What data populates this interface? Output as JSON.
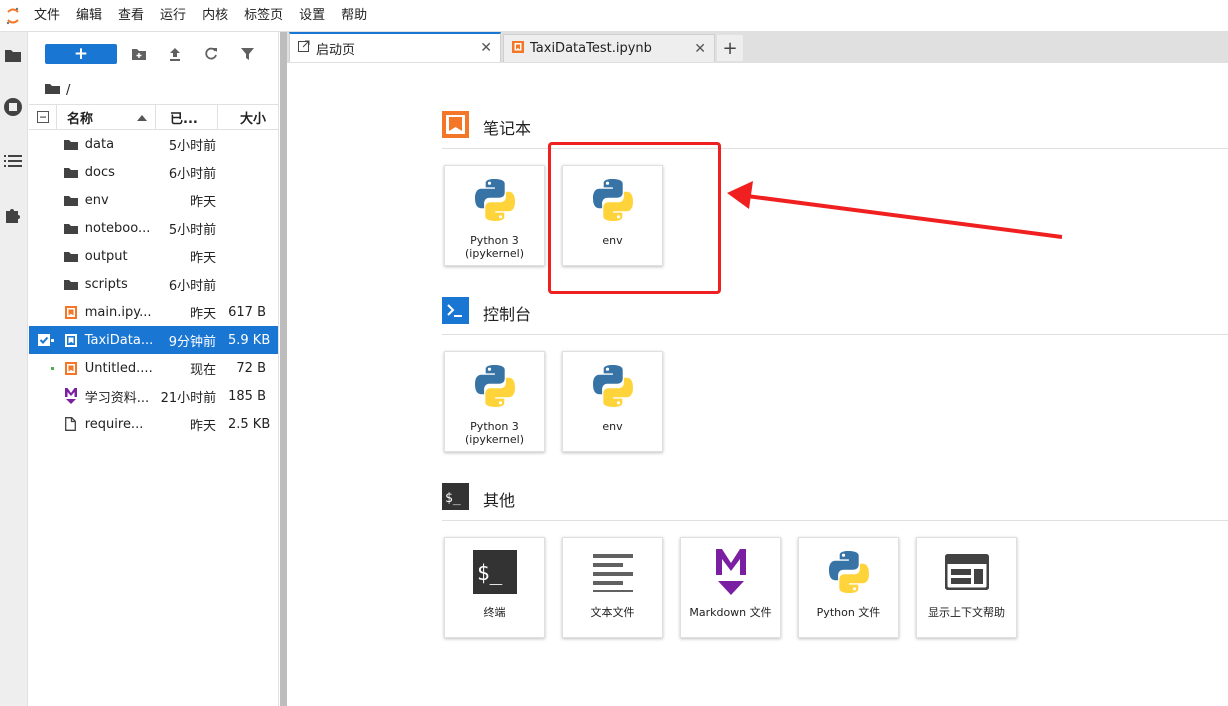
{
  "menubar": {
    "items": [
      "文件",
      "编辑",
      "查看",
      "运行",
      "内核",
      "标签页",
      "设置",
      "帮助"
    ]
  },
  "activitybar": {
    "icons": [
      "folder-icon",
      "running-icon",
      "toc-icon",
      "extension-icon"
    ]
  },
  "filebrowser": {
    "new_label": "+",
    "breadcrumb": "/",
    "columns": {
      "name": "名称",
      "modified": "已...",
      "size": "大小"
    },
    "files": [
      {
        "name": "data",
        "modified": "5小时前",
        "size": "",
        "type": "folder"
      },
      {
        "name": "docs",
        "modified": "6小时前",
        "size": "",
        "type": "folder"
      },
      {
        "name": "env",
        "modified": "昨天",
        "size": "",
        "type": "folder"
      },
      {
        "name": "noteboo...",
        "modified": "5小时前",
        "size": "",
        "type": "folder"
      },
      {
        "name": "output",
        "modified": "昨天",
        "size": "",
        "type": "folder"
      },
      {
        "name": "scripts",
        "modified": "6小时前",
        "size": "",
        "type": "folder"
      },
      {
        "name": "main.ipy...",
        "modified": "昨天",
        "size": "617 B",
        "type": "notebook"
      },
      {
        "name": "TaxiData...",
        "modified": "9分钟前",
        "size": "5.9 KB",
        "type": "notebook",
        "selected": true,
        "running": true
      },
      {
        "name": "Untitled....",
        "modified": "现在",
        "size": "72 B",
        "type": "notebook",
        "running": true
      },
      {
        "name": "学习资料...",
        "modified": "21小时前",
        "size": "185 B",
        "type": "markdown"
      },
      {
        "name": "require...",
        "modified": "昨天",
        "size": "2.5 KB",
        "type": "file"
      }
    ]
  },
  "tabs": [
    {
      "label": "启动页",
      "icon": "launcher-icon",
      "active": true
    },
    {
      "label": "TaxiDataTest.ipynb",
      "icon": "notebook-icon",
      "active": false
    }
  ],
  "launcher": {
    "sections": [
      {
        "title": "笔记本",
        "cards": [
          {
            "label": "Python 3\n(ipykernel)"
          },
          {
            "label": "env"
          }
        ]
      },
      {
        "title": "控制台",
        "cards": [
          {
            "label": "Python 3\n(ipykernel)"
          },
          {
            "label": "env"
          }
        ]
      },
      {
        "title": "其他",
        "cards": [
          {
            "label": "终端"
          },
          {
            "label": "文本文件"
          },
          {
            "label": "Markdown 文件"
          },
          {
            "label": "Python 文件"
          },
          {
            "label": "显示上下文帮助"
          }
        ]
      }
    ]
  },
  "colors": {
    "accent": "#1976d2",
    "notebook": "#f37726",
    "annotation": "#f02020",
    "markdown": "#7b1fa2"
  }
}
